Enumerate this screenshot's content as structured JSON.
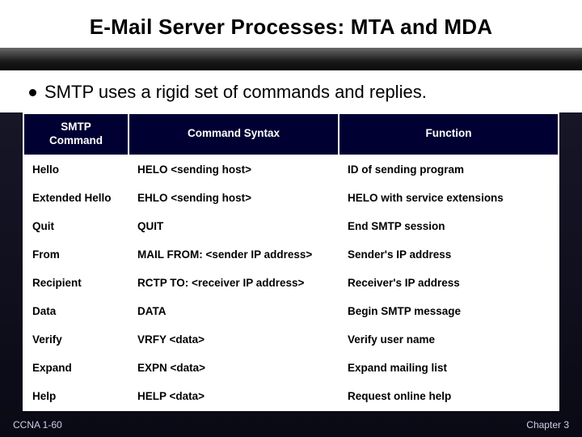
{
  "title": "E-Mail Server Processes: MTA and MDA",
  "bullet": "SMTP uses a rigid set of commands and replies.",
  "table": {
    "headers": {
      "col1": "SMTP\nCommand",
      "col2": "Command Syntax",
      "col3": "Function"
    },
    "rows": [
      {
        "cmd": "Hello",
        "syntax": "HELO <sending host>",
        "func": "ID of sending program"
      },
      {
        "cmd": "Extended Hello",
        "syntax": "EHLO <sending host>",
        "func": "HELO with service extensions"
      },
      {
        "cmd": "Quit",
        "syntax": "QUIT",
        "func": "End SMTP session"
      },
      {
        "cmd": "From",
        "syntax": "MAIL FROM: <sender IP address>",
        "func": "Sender's IP address"
      },
      {
        "cmd": "Recipient",
        "syntax": "RCTP TO: <receiver IP address>",
        "func": "Receiver's IP address"
      },
      {
        "cmd": "Data",
        "syntax": "DATA",
        "func": "Begin SMTP message"
      },
      {
        "cmd": "Verify",
        "syntax": "VRFY <data>",
        "func": "Verify user name"
      },
      {
        "cmd": "Expand",
        "syntax": "EXPN <data>",
        "func": "Expand mailing list"
      },
      {
        "cmd": "Help",
        "syntax": "HELP <data>",
        "func": "Request online help"
      }
    ]
  },
  "footer": {
    "left": "CCNA 1-60",
    "right": "Chapter 3"
  }
}
